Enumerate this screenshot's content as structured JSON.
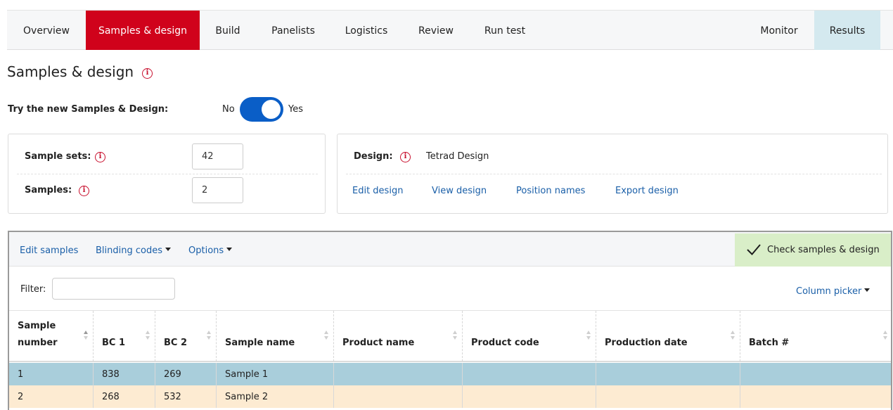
{
  "nav": {
    "tabs": [
      {
        "label": "Overview"
      },
      {
        "label": "Samples & design"
      },
      {
        "label": "Build"
      },
      {
        "label": "Panelists"
      },
      {
        "label": "Logistics"
      },
      {
        "label": "Review"
      },
      {
        "label": "Run test"
      }
    ],
    "right_tabs": [
      {
        "label": "Monitor"
      },
      {
        "label": "Results"
      }
    ],
    "active_tab": "Samples & design"
  },
  "page": {
    "title": "Samples & design",
    "info_glyph": "i"
  },
  "toggle": {
    "label": "Try the new Samples & Design:",
    "off_label": "No",
    "on_label": "Yes",
    "value": true
  },
  "samples_panel": {
    "sample_sets_label": "Sample sets:",
    "sample_sets_value": "42",
    "samples_label": "Samples:",
    "samples_value": "2"
  },
  "design_panel": {
    "design_label": "Design:",
    "design_value": "Tetrad Design",
    "links": [
      {
        "label": "Edit design"
      },
      {
        "label": "View design"
      },
      {
        "label": "Position names"
      },
      {
        "label": "Export design"
      }
    ]
  },
  "grid": {
    "toolbar": {
      "edit_samples": "Edit samples",
      "blinding_codes": "Blinding codes",
      "options": "Options",
      "check_button": "Check samples & design"
    },
    "filter_label": "Filter:",
    "filter_value": "",
    "column_picker": "Column picker",
    "columns": [
      {
        "label": "Sample number",
        "line1": "Sample",
        "line2": "number"
      },
      {
        "label": "BC 1"
      },
      {
        "label": "BC 2"
      },
      {
        "label": "Sample name"
      },
      {
        "label": "Product name"
      },
      {
        "label": "Product code"
      },
      {
        "label": "Production date"
      },
      {
        "label": "Batch #"
      }
    ],
    "rows": [
      {
        "cells": [
          "1",
          "838",
          "269",
          "Sample 1",
          "",
          "",
          "",
          ""
        ],
        "state": "selected"
      },
      {
        "cells": [
          "2",
          "268",
          "532",
          "Sample 2",
          "",
          "",
          "",
          ""
        ],
        "state": "normal"
      }
    ]
  },
  "colors": {
    "brand_red": "#d0021b",
    "results_tab": "#d4e9ef",
    "toggle_blue": "#0a5ec7",
    "link_blue": "#1a5fa8",
    "check_green": "#d9eec8",
    "selected_row": "#a9cedb",
    "alt_row": "#fdebd2"
  },
  "icons": {
    "info": "info-circle-icon",
    "check": "checkmark-icon",
    "sort": "sort-arrows-icon",
    "caret": "caret-down-icon"
  }
}
